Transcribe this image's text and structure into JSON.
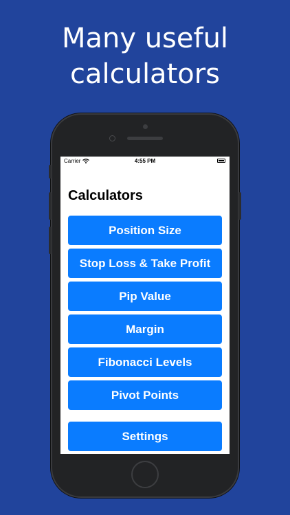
{
  "headline": {
    "line1": "Many useful",
    "line2": "calculators"
  },
  "status_bar": {
    "carrier": "Carrier",
    "time": "4:55 PM"
  },
  "screen": {
    "title": "Calculators",
    "menu": [
      {
        "label": "Position Size"
      },
      {
        "label": "Stop Loss & Take Profit"
      },
      {
        "label": "Pip Value"
      },
      {
        "label": "Margin"
      },
      {
        "label": "Fibonacci Levels"
      },
      {
        "label": "Pivot Points"
      }
    ],
    "settings_label": "Settings"
  },
  "colors": {
    "background": "#21449c",
    "button": "#0a7cff",
    "button_text": "#ffffff",
    "phone_frame": "#222325"
  }
}
